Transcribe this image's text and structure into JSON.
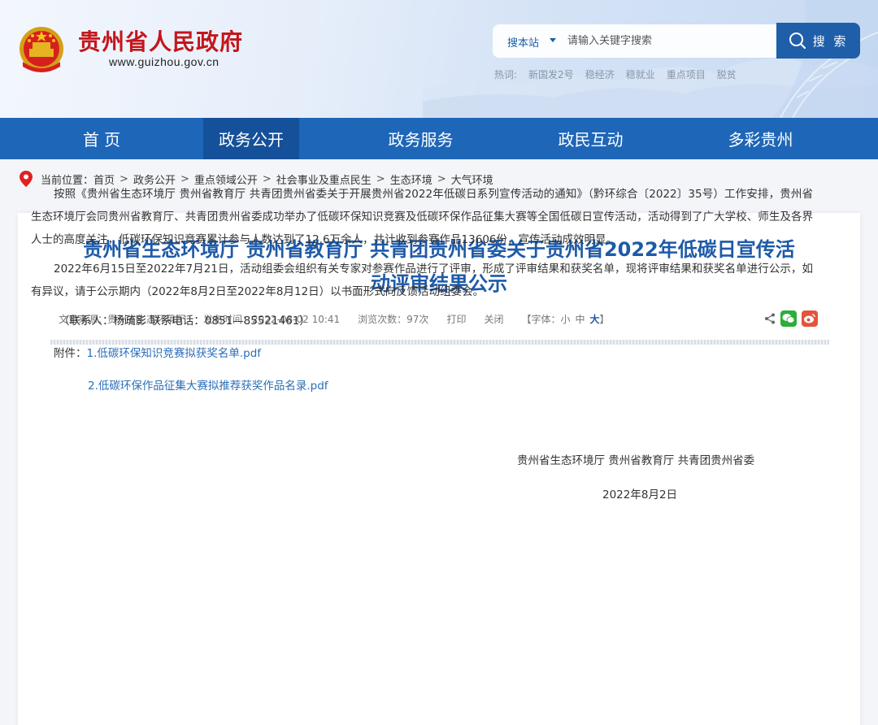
{
  "header": {
    "site_title": "贵州省人民政府",
    "site_url": "www.guizhou.gov.cn",
    "search_scope": "搜本站",
    "search_placeholder": "请输入关键字搜索",
    "search_button": "搜 索",
    "hot_label": "热词:",
    "hot_words": [
      "新国发2号",
      "稳经济",
      "稳就业",
      "重点项目",
      "脱贫"
    ]
  },
  "nav": {
    "items": [
      "首 页",
      "政务公开",
      "政务服务",
      "政民互动",
      "多彩贵州"
    ],
    "active_index": 1
  },
  "breadcrumb": {
    "label": "当前位置：",
    "items": [
      "首页",
      "政务公开",
      "重点领域公开",
      "社会事业及重点民生",
      "生态环境",
      "大气环境"
    ],
    "separator": ">"
  },
  "article": {
    "title_line1": "贵州省生态环境厅 贵州省教育厅 共青团贵州省委关于贵州省2022年低碳日宣传活",
    "title_line2": "动评审结果公示",
    "source": "文章来源：贵州省生态环境厅",
    "publish_time": "发布时间：2022-08-02 10:41",
    "views": "浏览次数：97次",
    "print": "打印",
    "close": "关闭",
    "font_label": "【字体：",
    "font_small": "小",
    "font_medium": "中",
    "font_large": "大",
    "font_end": "】",
    "paragraphs": [
      "按照《贵州省生态环境厅 贵州省教育厅 共青团贵州省委关于开展贵州省2022年低碳日系列宣传活动的通知》（黔环综合〔2022〕35号）工作安排，贵州省生态环境厅会同贵州省教育厅、共青团贵州省委成功举办了低碳环保知识竞赛及低碳环保作品征集大赛等全国低碳日宣传活动，活动得到了广大学校、师生及各界人士的高度关注，低碳环保知识竞赛累计参与人数达到了12.6万余人，共计收到参赛作品13606份，宣传活动成效明显。",
      "2022年6月15日至2022年7月21日，活动组委会组织有关专家对参赛作品进行了评审，形成了评审结果和获奖名单，现将评审结果和获奖名单进行公示，如有异议，请于公示期内（2022年8月2日至2022年8月12日）以书面形式向反馈活动组委会。"
    ],
    "contact": "（联系人：杨疏影 联系电话：0851—85521461）",
    "attachment_label": "附件：",
    "attachments": [
      "1.低碳环保知识竞赛拟获奖名单.pdf",
      "2.低碳环保作品征集大赛拟推荐获奖作品名录.pdf"
    ],
    "signature": "贵州省生态环境厅 贵州省教育厅 共青团贵州省委",
    "date": "2022年8月2日"
  },
  "colors": {
    "nav_bg": "#1e66b8",
    "nav_active": "#15509a",
    "title": "#1d5aa8",
    "brand_red": "#c4161c",
    "link": "#2a6db8"
  }
}
